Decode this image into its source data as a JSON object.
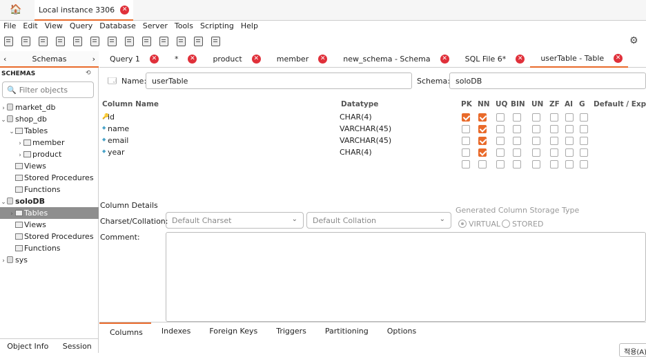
{
  "connection_tab": {
    "label": "Local instance 3306"
  },
  "menu": [
    "File",
    "Edit",
    "View",
    "Query",
    "Database",
    "Server",
    "Tools",
    "Scripting",
    "Help"
  ],
  "sidebar": {
    "title": "Schemas",
    "section": "SCHEMAS",
    "filter_placeholder": "Filter objects",
    "tree": [
      {
        "label": "market_db",
        "level": 0,
        "arrow": "›",
        "icon": "db"
      },
      {
        "label": "shop_db",
        "level": 0,
        "arrow": "⌄",
        "icon": "db"
      },
      {
        "label": "Tables",
        "level": 1,
        "arrow": "⌄",
        "icon": "folder"
      },
      {
        "label": "member",
        "level": 2,
        "arrow": "›",
        "icon": "table"
      },
      {
        "label": "product",
        "level": 2,
        "arrow": "›",
        "icon": "table"
      },
      {
        "label": "Views",
        "level": 1,
        "arrow": "",
        "icon": "folder"
      },
      {
        "label": "Stored Procedures",
        "level": 1,
        "arrow": "",
        "icon": "folder"
      },
      {
        "label": "Functions",
        "level": 1,
        "arrow": "",
        "icon": "folder"
      },
      {
        "label": "soloDB",
        "level": 0,
        "arrow": "⌄",
        "icon": "db",
        "bold": true
      },
      {
        "label": "Tables",
        "level": 1,
        "arrow": "›",
        "icon": "folder",
        "selected": true
      },
      {
        "label": "Views",
        "level": 1,
        "arrow": "",
        "icon": "folder"
      },
      {
        "label": "Stored Procedures",
        "level": 1,
        "arrow": "",
        "icon": "folder"
      },
      {
        "label": "Functions",
        "level": 1,
        "arrow": "",
        "icon": "folder"
      },
      {
        "label": "sys",
        "level": 0,
        "arrow": "›",
        "icon": "db"
      }
    ],
    "bottom": {
      "object_info": "Object Info",
      "session": "Session"
    }
  },
  "doc_tabs": [
    {
      "label": "Query 1"
    },
    {
      "label": "*"
    },
    {
      "label": "product"
    },
    {
      "label": "member"
    },
    {
      "label": "new_schema - Schema"
    },
    {
      "label": "SQL File 6*"
    },
    {
      "label": "userTable - Table",
      "active": true
    }
  ],
  "editor": {
    "name_label": "Name:",
    "name_value": "userTable",
    "schema_label": "Schema:",
    "schema_value": "soloDB",
    "headers": {
      "column": "Column Name",
      "datatype": "Datatype",
      "flags": [
        "PK",
        "NN",
        "UQ",
        "BIN",
        "UN",
        "ZF",
        "AI",
        "G"
      ],
      "default": "Default / Expre"
    },
    "columns": [
      {
        "name": "id",
        "type": "CHAR(4)",
        "key": true,
        "flags": [
          1,
          1,
          0,
          0,
          0,
          0,
          0,
          0
        ]
      },
      {
        "name": "name",
        "type": "VARCHAR(45)",
        "flags": [
          0,
          1,
          0,
          0,
          0,
          0,
          0,
          0
        ]
      },
      {
        "name": "email",
        "type": "VARCHAR(45)",
        "flags": [
          0,
          1,
          0,
          0,
          0,
          0,
          0,
          0
        ]
      },
      {
        "name": "year",
        "type": "CHAR(4)",
        "flags": [
          0,
          1,
          0,
          0,
          0,
          0,
          0,
          0
        ]
      },
      {
        "name": "",
        "type": "",
        "flags": [
          0,
          0,
          0,
          0,
          0,
          0,
          0,
          0
        ],
        "empty": true
      }
    ],
    "details": {
      "title": "Column Details",
      "charset_label": "Charset/Collation:",
      "charset_value": "Default Charset",
      "collation_value": "Default Collation",
      "storage_label": "Generated Column Storage Type",
      "virtual": "VIRTUAL",
      "stored": "STORED",
      "comment_label": "Comment:"
    },
    "bottom_tabs": [
      {
        "label": "Columns",
        "active": true
      },
      {
        "label": "Indexes"
      },
      {
        "label": "Foreign Keys"
      },
      {
        "label": "Triggers"
      },
      {
        "label": "Partitioning"
      },
      {
        "label": "Options"
      }
    ],
    "apply_label": "적용(A)"
  },
  "colors": {
    "accent": "#e96a2a",
    "close": "#e0303a",
    "selected": "#8e8e8e"
  }
}
